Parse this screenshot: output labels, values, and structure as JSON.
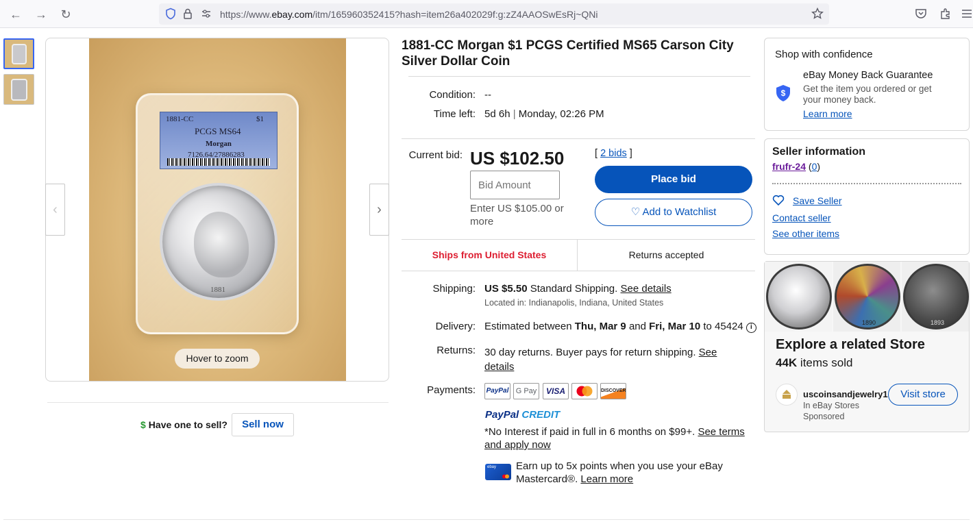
{
  "browser": {
    "url_prefix": "https://www.",
    "url_domain": "ebay.com",
    "url_rest": "/itm/165960352415?hash=item26a402029f:g:zZ4AAOSwEsRj~QNi"
  },
  "gallery": {
    "zoom_label": "Hover to zoom",
    "slab_grade_line1": "1881-CC",
    "slab_grade_line1b": "$1",
    "slab_grade_line2": "PCGS MS64",
    "slab_grade_line3": "Morgan",
    "slab_grade_line4": "7126.64/27886283",
    "coin_date": "1881",
    "sell_question": "Have one to sell?",
    "sell_button": "Sell now",
    "dollar_icon": "$"
  },
  "item": {
    "title": "1881-CC Morgan $1 PCGS Certified MS65 Carson City Silver Dollar Coin",
    "condition_label": "Condition:",
    "condition_value": "--",
    "time_left_label": "Time left:",
    "time_left_value": "5d 6h",
    "time_left_sep": "|",
    "time_left_end": "Monday, 02:26 PM",
    "current_bid_label": "Current bid:",
    "current_bid_value": "US $102.50",
    "bids_open": "[",
    "bids_link": "2 bids",
    "bids_close": "]",
    "bid_placeholder": "Bid Amount",
    "bid_hint": "Enter US $105.00 or more",
    "place_bid": "Place bid",
    "watchlist": "Add to Watchlist",
    "ships_from": "Ships from United States",
    "returns_accepted": "Returns accepted"
  },
  "details": {
    "shipping_label": "Shipping:",
    "shipping_price": "US $5.50",
    "shipping_method": "Standard Shipping.",
    "shipping_link": "See details",
    "located": "Located in: Indianapolis, Indiana, United States",
    "delivery_label": "Delivery:",
    "delivery_pre": "Estimated between",
    "delivery_d1": "Thu, Mar 9",
    "delivery_and": "and",
    "delivery_d2": "Fri, Mar 10",
    "delivery_to": "to 45424",
    "returns_label": "Returns:",
    "returns_text": "30 day returns. Buyer pays for return shipping.",
    "returns_link_a": "See",
    "returns_link_b": "details",
    "payments_label": "Payments:",
    "pay_logos": [
      "PayPal",
      "G Pay",
      "VISA",
      "",
      "DISCOVER"
    ],
    "paypal_credit_a": "PayPal",
    "paypal_credit_b": "CREDIT",
    "credit_text": "*No Interest if paid in full in 6 months on $99+.",
    "credit_link_a": "See terms",
    "credit_link_b": "and apply now",
    "card_text_a": "Earn up to 5x points when you use your eBay",
    "card_text_b": "Mastercard®.",
    "card_link": "Learn more",
    "card_mini_label": "ebay"
  },
  "confidence": {
    "title": "Shop with confidence",
    "guarantee_title": "eBay Money Back Guarantee",
    "guarantee_text_a": "Get the item you ordered or get",
    "guarantee_text_b": "your money back.",
    "learn_more": "Learn more"
  },
  "seller": {
    "title": "Seller information",
    "name": "frufr-24",
    "feedback_open": "(",
    "feedback": "0",
    "feedback_close": ")",
    "save": "Save Seller",
    "contact": "Contact seller",
    "other": "See other items"
  },
  "store": {
    "title": "Explore a related Store",
    "sold_count": "44K",
    "sold_label": "items sold",
    "coin_dates": [
      "",
      "1890",
      "1893"
    ],
    "store_name": "uscoinsandjewelry1",
    "store_sub": "In eBay Stores",
    "sponsored": "Sponsored",
    "visit": "Visit store"
  },
  "colors": {
    "ebay_blue": "#0654ba",
    "ships_red": "#dd1e31",
    "link_purple": "#6a1b9a"
  }
}
